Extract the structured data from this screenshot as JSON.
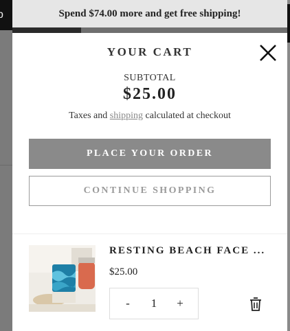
{
  "background": {
    "strip_text": "p"
  },
  "banner": {
    "text": "Spend $74.00 more and get free shipping!",
    "progress": 0.25
  },
  "cart": {
    "title": "YOUR CART",
    "close_icon": "close-icon",
    "subtotal_label": "SUBTOTAL",
    "subtotal_value": "$25.00",
    "taxes_before": "Taxes and ",
    "taxes_link": "shipping",
    "taxes_after": " calculated at checkout",
    "place_order_label": "PLACE YOUR ORDER",
    "continue_label": "CONTINUE SHOPPING"
  },
  "items": [
    {
      "title": "RESTING BEACH FACE ...",
      "price": "$25.00",
      "quantity": "1",
      "minus": "-",
      "plus": "+",
      "remove_icon": "trash-icon"
    }
  ],
  "colors": {
    "overlay": "#7b7b7b",
    "banner_bg": "#e6e6e6",
    "primary_button": "#8a8a8a",
    "secondary_border": "#9a9a9a",
    "link": "#888888"
  }
}
